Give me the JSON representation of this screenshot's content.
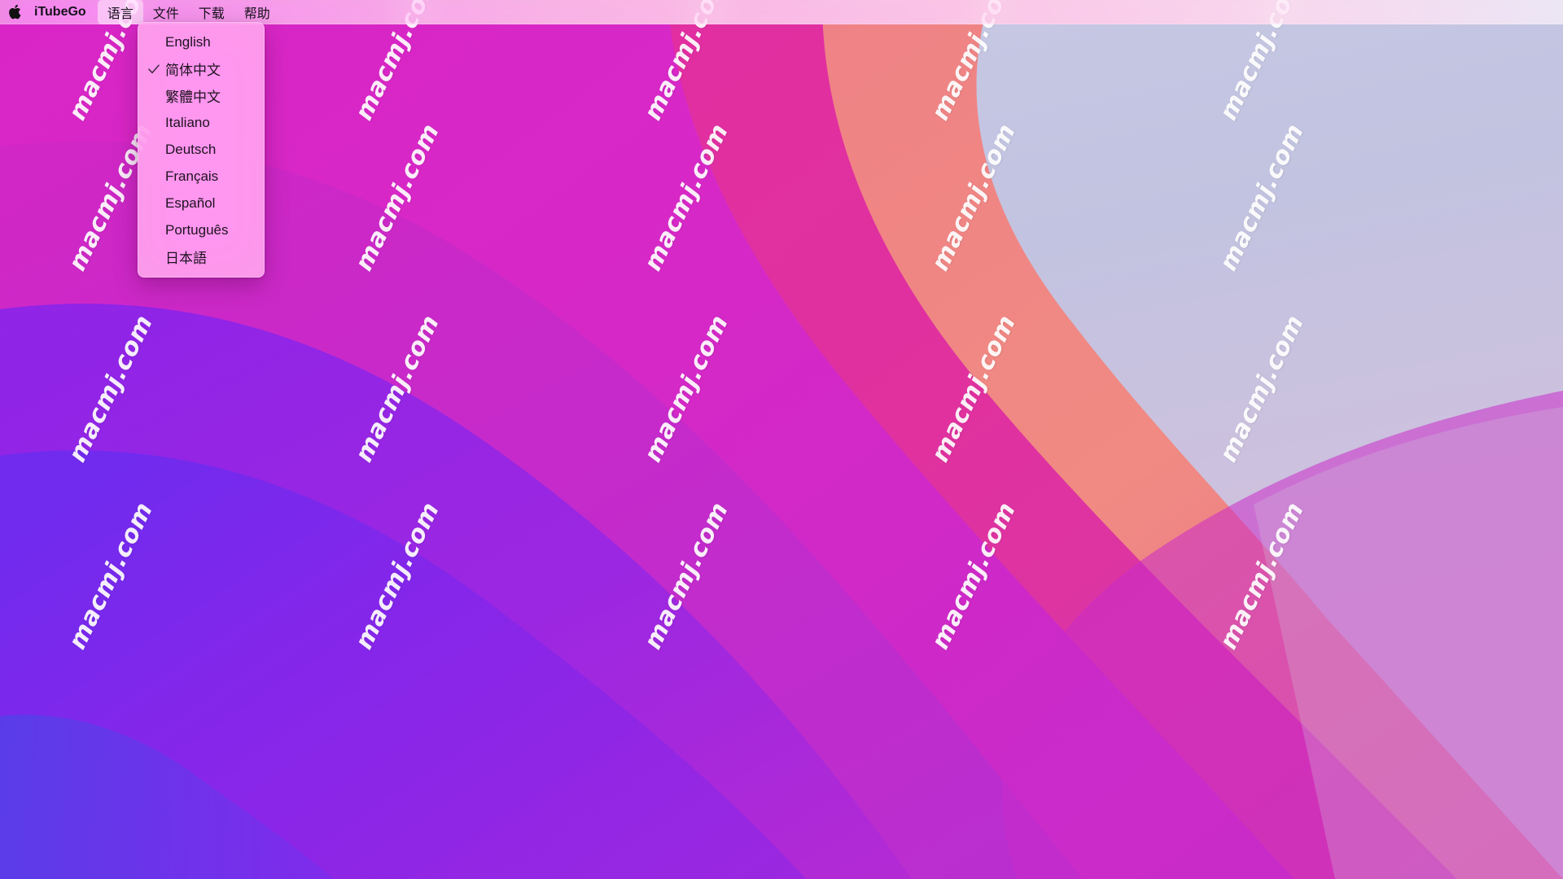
{
  "menubar": {
    "apple_icon": "apple-logo-icon",
    "app_name": "iTubeGo",
    "items": [
      {
        "label": "语言",
        "active": true
      },
      {
        "label": "文件",
        "active": false
      },
      {
        "label": "下载",
        "active": false
      },
      {
        "label": "帮助",
        "active": false
      }
    ]
  },
  "language_menu": {
    "open": true,
    "checkmark_icon": "checkmark-icon",
    "items": [
      {
        "label": "English",
        "checked": false
      },
      {
        "label": "简体中文",
        "checked": true
      },
      {
        "label": "繁體中文",
        "checked": false
      },
      {
        "label": "Italiano",
        "checked": false
      },
      {
        "label": "Deutsch",
        "checked": false
      },
      {
        "label": "Français",
        "checked": false
      },
      {
        "label": "Español",
        "checked": false
      },
      {
        "label": "Português",
        "checked": false
      },
      {
        "label": "日本語",
        "checked": false
      }
    ]
  },
  "desktop": {
    "watermark_text": "macmj.com",
    "watermark_count": 20
  },
  "colors": {
    "menubar_tint": "#f0a8dc",
    "menu_background": "#ffafec",
    "menu_text": "#1d1320",
    "wallpaper_magenta": "#d326c8",
    "wallpaper_pink": "#e0309e",
    "wallpaper_violet": "#8a2be8",
    "wallpaper_salmon": "#ef7b7e",
    "wallpaper_lavender": "#c3c6e2",
    "wallpaper_blush": "#e9b6d4"
  }
}
